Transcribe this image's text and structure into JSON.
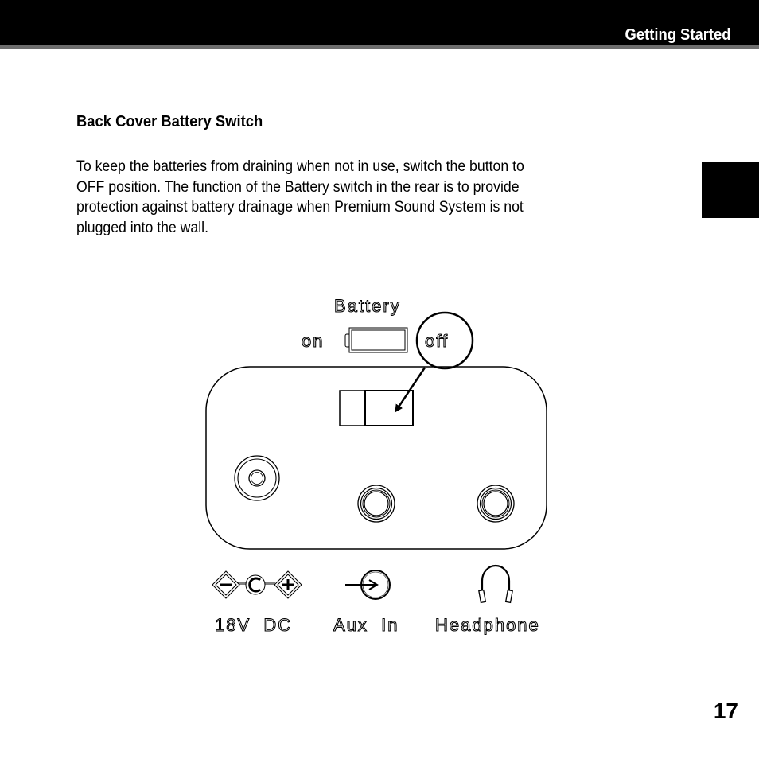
{
  "header": {
    "section_title": "Getting Started"
  },
  "content": {
    "heading": "Back Cover Battery Switch",
    "paragraph_lines": [
      "To keep the batteries from draining when not in use, switch the button to",
      "OFF position. The function of the Battery switch in the rear is to provide",
      "protection against battery drainage when Premium Sound System is not",
      "plugged into the wall."
    ]
  },
  "diagram": {
    "battery_label": "Battery",
    "on_label": "on",
    "off_label": "off",
    "switch_state": "off",
    "ports": [
      {
        "id": "dc",
        "label": "18V  DC",
        "icon": "dc-polarity-icon"
      },
      {
        "id": "aux",
        "label": "Aux  In",
        "icon": "aux-input-icon"
      },
      {
        "id": "headphone",
        "label": "Headphone",
        "icon": "headphone-icon"
      }
    ]
  },
  "footer": {
    "page_number": "17"
  }
}
